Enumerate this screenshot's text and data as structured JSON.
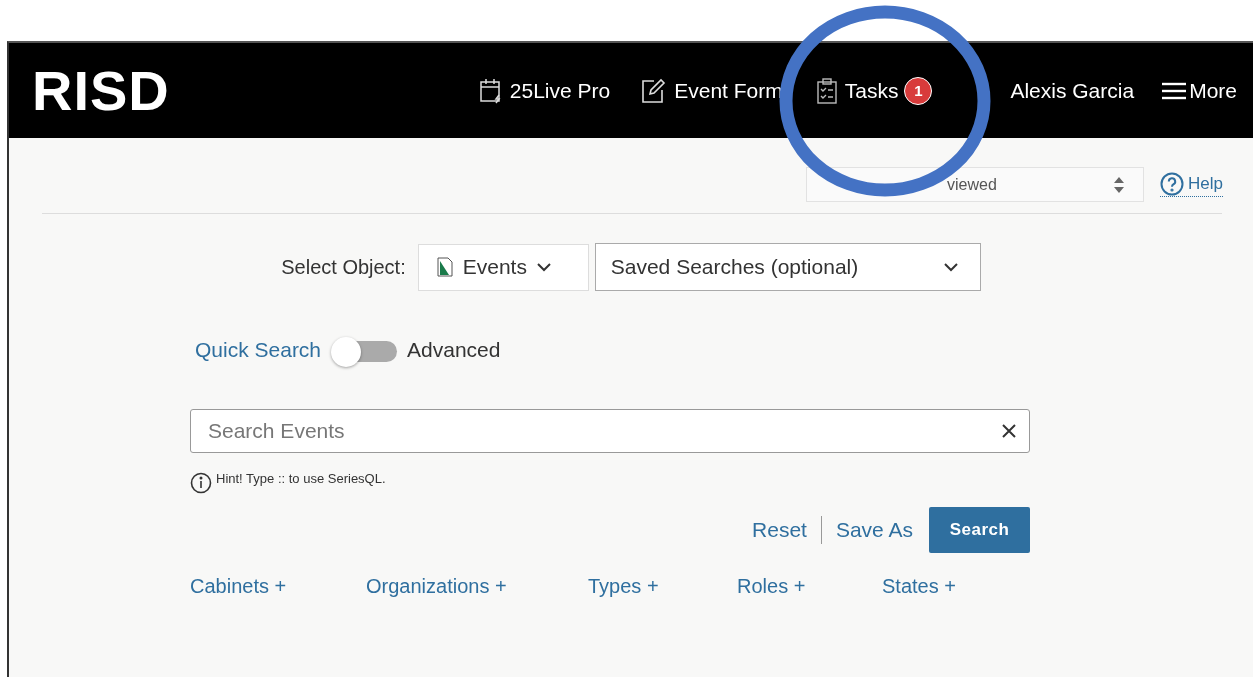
{
  "header": {
    "logo": "RISD",
    "nav": [
      {
        "kind": "calendar",
        "label": "25Live Pro"
      },
      {
        "kind": "form",
        "label": "Event Form"
      },
      {
        "kind": "tasks",
        "label": "Tasks",
        "badge": "1"
      },
      {
        "kind": "user",
        "label": "Alexis Garcia"
      },
      {
        "kind": "menu",
        "label": "More"
      }
    ]
  },
  "recent": {
    "value": "viewed"
  },
  "help": "Help",
  "select_object": {
    "label": "Select Object:",
    "object": "Events",
    "saved_searches": "Saved Searches (optional)"
  },
  "mode": {
    "left": "Quick Search",
    "right": "Advanced",
    "on": false
  },
  "search": {
    "placeholder": "Search Events"
  },
  "hint": "Hint! Type :: to use SeriesQL.",
  "actions": [
    {
      "kind": "link",
      "label": "Reset"
    },
    {
      "kind": "link",
      "label": "Save As"
    },
    {
      "kind": "primary",
      "label": "Search"
    }
  ],
  "filters": [
    "Cabinets +",
    "Organizations +",
    "Types +",
    "Roles +",
    "States +"
  ]
}
